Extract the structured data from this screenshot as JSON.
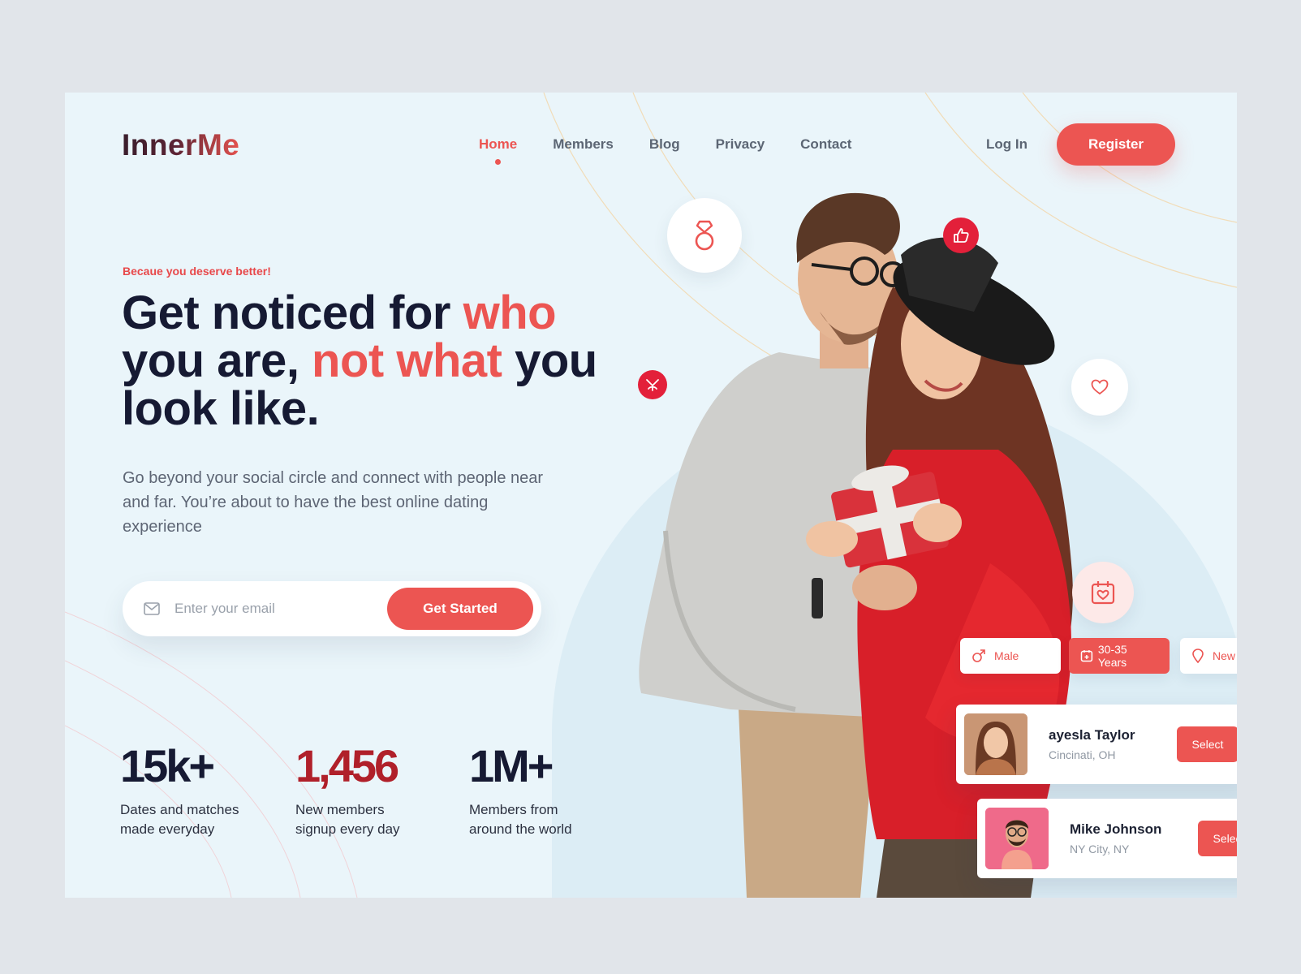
{
  "brand": {
    "name": "InnerMe"
  },
  "nav": {
    "items": [
      {
        "label": "Home",
        "active": true
      },
      {
        "label": "Members",
        "active": false
      },
      {
        "label": "Blog",
        "active": false
      },
      {
        "label": "Privacy",
        "active": false
      },
      {
        "label": "Contact",
        "active": false
      }
    ],
    "login_label": "Log In",
    "register_label": "Register"
  },
  "hero": {
    "tagline": "Becaue you deserve better!",
    "headline": {
      "part1": "Get noticed for ",
      "accent1": "who",
      "part2": " you are, ",
      "accent2": "not what",
      "part3": " you look like."
    },
    "description": "Go beyond your social circle and connect with people near and far. You’re about to have the best online dating experience",
    "email_placeholder": "Enter your email",
    "cta_label": "Get Started"
  },
  "stats": [
    {
      "value": "15k+",
      "label": "Dates and matches made everyday"
    },
    {
      "value": "1,456",
      "label": "New members signup every day"
    },
    {
      "value": "1M+",
      "label": "Members from around the world"
    }
  ],
  "filters": [
    {
      "icon": "male-icon",
      "label": "Male"
    },
    {
      "icon": "calendar-icon",
      "label": "30-35 Years"
    },
    {
      "icon": "location-pin-icon",
      "label": "New York"
    }
  ],
  "profiles": [
    {
      "name": "ayesla Taylor",
      "location": "Cincinati, OH",
      "action": "Select"
    },
    {
      "name": "Mike Johnson",
      "location": "NY City, NY",
      "action": "Select"
    }
  ],
  "floating_icons": [
    "ring-icon",
    "thumbs-up-icon",
    "cupid-icon",
    "heart-icon",
    "calendar-heart-icon"
  ],
  "colors": {
    "accent": "#ec5552",
    "deep_red": "#b0202a",
    "dark_text": "#161a33",
    "background": "#eaf5fa",
    "page_bg": "#e1e5ea"
  }
}
